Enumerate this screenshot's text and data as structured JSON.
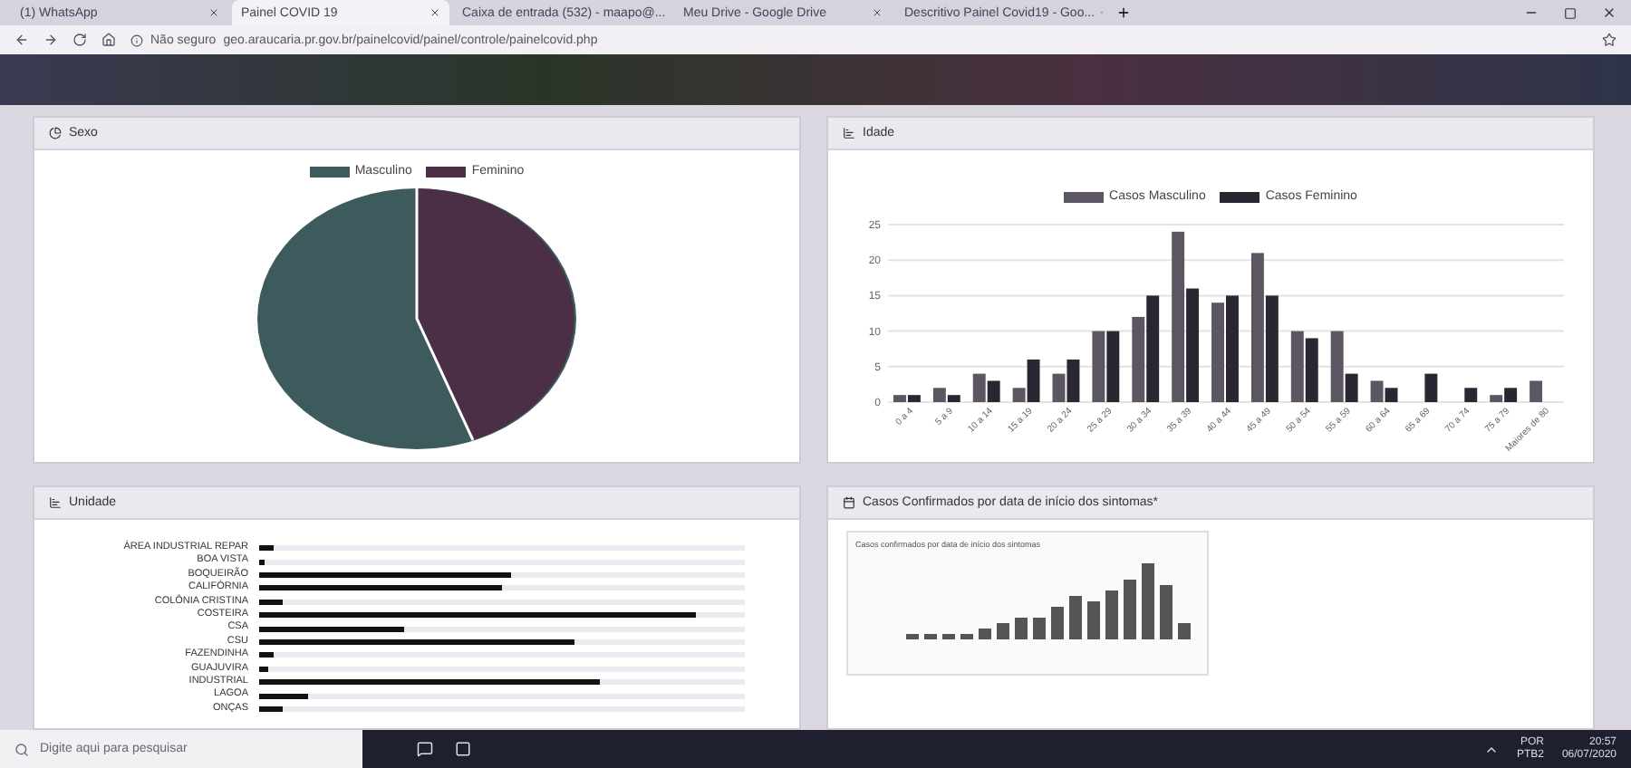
{
  "browser": {
    "tabs": [
      {
        "title": "(1) WhatsApp",
        "selected": false
      },
      {
        "title": "Painel COVID 19",
        "selected": true
      },
      {
        "title": "Caixa de entrada (532) - maapo@...",
        "selected": false
      },
      {
        "title": "Meu Drive - Google Drive",
        "selected": false
      },
      {
        "title": "Descritivo Painel Covid19 - Goo...",
        "selected": false
      }
    ],
    "security": "Não seguro",
    "url": "geo.araucaria.pr.gov.br/painelcovid/painel/controle/painelcovid.php"
  },
  "panels": {
    "sexo": {
      "title": "Sexo",
      "legend": [
        {
          "name": "Masculino",
          "color": "#3d5b5c"
        },
        {
          "name": "Feminino",
          "color": "#4b2f47"
        }
      ]
    },
    "idade": {
      "title": "Idade",
      "chart_data": {
        "type": "bar",
        "categories": [
          "0 a 4",
          "5 a 9",
          "10 a 14",
          "15 a 19",
          "20 a 24",
          "25 a 29",
          "30 a 34",
          "35 a 39",
          "40 a 44",
          "45 a 49",
          "50 a 54",
          "55 a 59",
          "60 a 64",
          "65 a 69",
          "70 a 74",
          "75 a 79",
          "Maiores de 80"
        ],
        "series": [
          {
            "name": "Casos Masculino",
            "color": "#5b5661",
            "values": [
              1,
              2,
              4,
              2,
              4,
              10,
              12,
              24,
              14,
              21,
              10,
              10,
              3,
              0,
              0,
              1,
              3
            ]
          },
          {
            "name": "Casos Feminino",
            "color": "#2a2632",
            "values": [
              1,
              1,
              3,
              6,
              6,
              10,
              15,
              16,
              15,
              15,
              9,
              4,
              2,
              4,
              2,
              2,
              0
            ]
          }
        ],
        "ylim": [
          0,
          25
        ],
        "yticks": [
          0,
          5,
          10,
          15,
          20,
          25
        ],
        "grid": true
      }
    },
    "unidade": {
      "title": "Unidade",
      "rows": [
        {
          "label": "ÁREA INDUSTRIAL REPAR",
          "level": 0.03
        },
        {
          "label": "BOA VISTA",
          "level": 0.01
        },
        {
          "label": "BOQUEIRÃO",
          "level": 0.52
        },
        {
          "label": "CALIFÓRNIA",
          "level": 0.5
        },
        {
          "label": "COLÔNIA CRISTINA",
          "level": 0.05
        },
        {
          "label": "COSTEIRA",
          "level": 0.9
        },
        {
          "label": "CSA",
          "level": 0.3
        },
        {
          "label": "CSU",
          "level": 0.65
        },
        {
          "label": "FAZENDINHA",
          "level": 0.03
        },
        {
          "label": "GUAJUVIRA",
          "level": 0.02
        },
        {
          "label": "INDUSTRIAL",
          "level": 0.7
        },
        {
          "label": "LAGOA",
          "level": 0.1
        },
        {
          "label": "ONÇAS",
          "level": 0.05
        }
      ]
    },
    "sintomas": {
      "title": "Casos Confirmados por data de início dos sintomas*",
      "inner_title": "Casos confirmados por data de início dos sintomas"
    }
  },
  "taskbar": {
    "search_placeholder": "Digite aqui para pesquisar",
    "language": "POR",
    "layout": "PTB2",
    "time": "20:57",
    "date": "06/07/2020"
  }
}
